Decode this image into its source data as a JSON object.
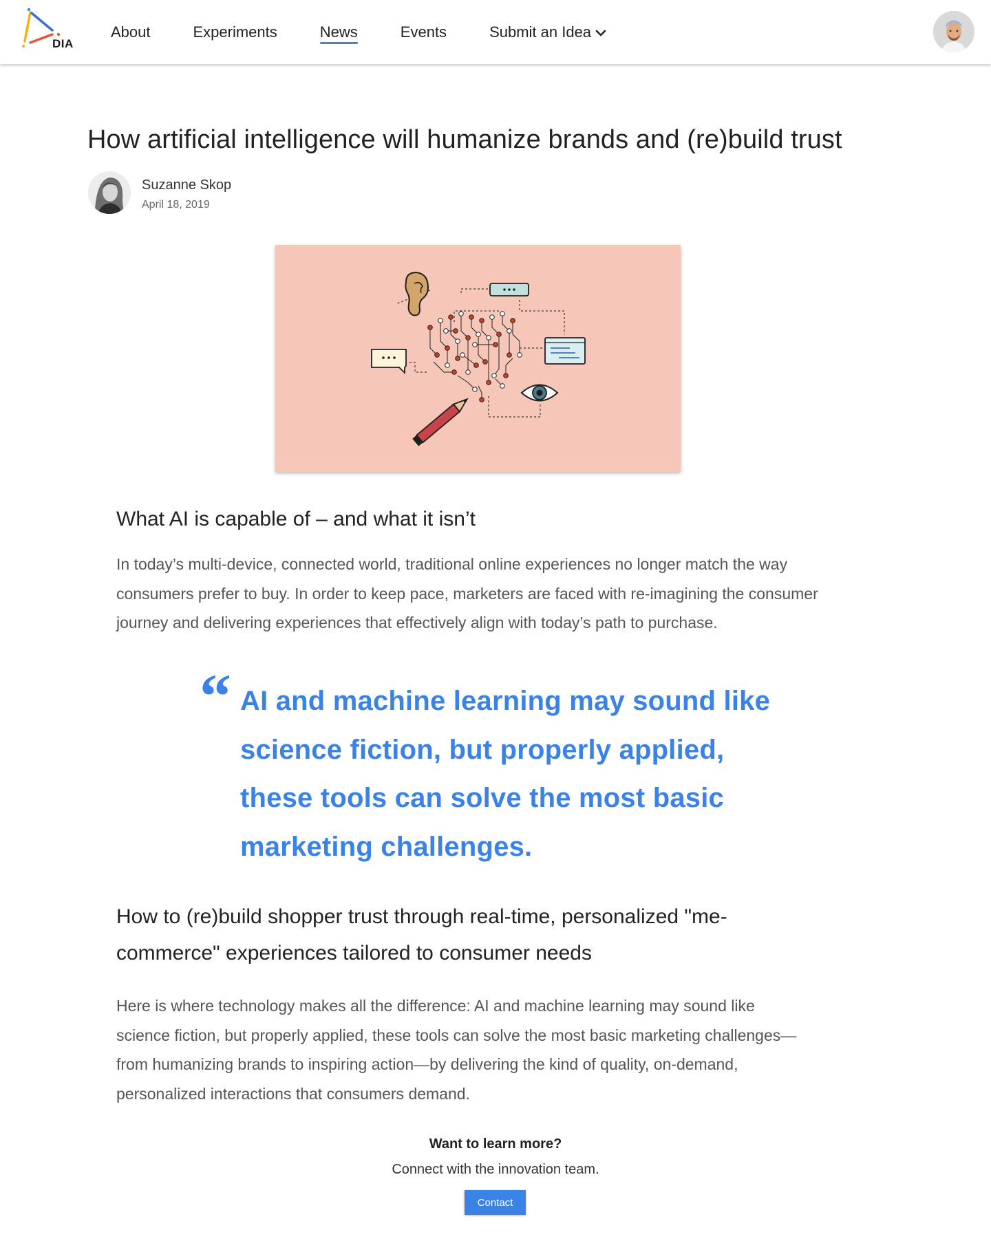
{
  "brand": {
    "logo_text": "DIA",
    "accent": "#3b82e6"
  },
  "nav": {
    "items": [
      {
        "label": "About"
      },
      {
        "label": "Experiments"
      },
      {
        "label": "News",
        "active": true
      },
      {
        "label": "Events"
      },
      {
        "label": "Submit an Idea",
        "has_dropdown": true
      }
    ]
  },
  "article": {
    "title": "How artificial intelligence will humanize brands and (re)build trust",
    "author": "Suzanne Skop",
    "date": "April 18, 2019",
    "hero_bg": "#f6c7b8",
    "section1_heading": "What AI is capable of – and what it isn’t",
    "section1_body": "In today’s multi-device, connected world, traditional online experiences no longer match the way consumers prefer to buy. In order to keep pace, marketers are faced with re-imagining the consumer journey and delivering experiences that effectively align with today’s path to purchase.",
    "pull_quote": "AI and machine learning may sound like science fiction, but properly applied, these tools can solve the most basic marketing challenges.",
    "section2_heading": "How to (re)build shopper trust through real-time, personalized \"me-commerce\" experiences tailored to consumer needs",
    "section2_body": "Here is where technology makes all the difference: AI and machine learning may sound like science fiction, but properly applied, these tools can solve the most basic marketing challenges—from humanizing brands to inspiring action—by delivering the kind of quality, on-demand, personalized interactions that consumers demand."
  },
  "cta": {
    "question": "Want to learn more?",
    "subtitle": "Connect with the innovation team.",
    "button_label": "Contact"
  }
}
